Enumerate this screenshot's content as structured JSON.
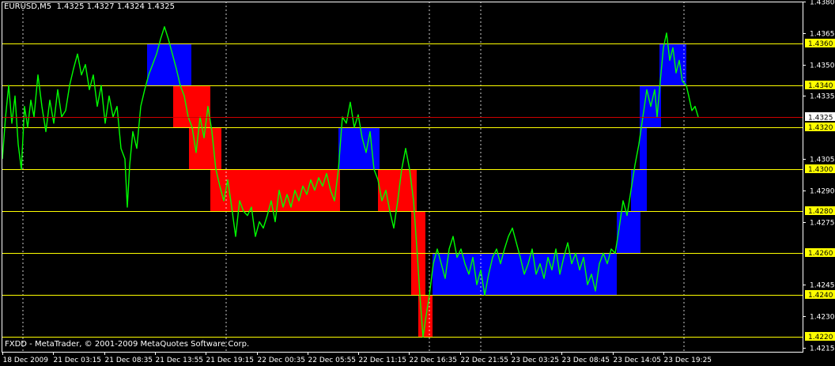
{
  "header": {
    "symbol_tf": "EURUSD,M5",
    "ohlc": "1.4325 1.4327 1.4324 1.4325"
  },
  "footer": {
    "copyright": "FXDD - MetaTrader, © 2001-2009 MetaQuotes Software Corp."
  },
  "colors": {
    "background": "#000000",
    "axis": "#ffffff",
    "price_line": "#00ff00",
    "box_up": "#0000ff",
    "box_down": "#ff0000",
    "level_line": "#ffff00",
    "level_label_bg": "#ffff00",
    "current_price_line": "#cc0000",
    "current_price_label_bg": "#ffffff"
  },
  "chart_data": {
    "type": "line",
    "symbol": "EURUSD",
    "timeframe": "M5",
    "ylim": [
      1.4213,
      1.438
    ],
    "y_axis_labels": [
      "1.4380",
      "1.4365",
      "1.4350",
      "1.4335",
      "1.4305",
      "1.4290",
      "1.4275",
      "1.4245",
      "1.4230",
      "1.4215"
    ],
    "level_labels": [
      "1.4360",
      "1.4340",
      "1.4320",
      "1.4300",
      "1.4280",
      "1.4260",
      "1.4240",
      "1.4220"
    ],
    "current_price": "1.4325",
    "x_tick_labels": [
      "18 Dec 2009",
      "21 Dec 03:15",
      "21 Dec 08:35",
      "21 Dec 13:55",
      "21 Dec 19:15",
      "22 Dec 00:35",
      "22 Dec 05:55",
      "22 Dec 11:15",
      "22 Dec 16:35",
      "22 Dec 21:55",
      "23 Dec 03:25",
      "23 Dec 08:45",
      "23 Dec 14:05",
      "23 Dec 19:25"
    ],
    "vertical_grid_after_tick": [
      0,
      4,
      8,
      9,
      13
    ],
    "grid": "dotted vertical",
    "price_path": [
      [
        0,
        1.4305
      ],
      [
        4,
        1.4325
      ],
      [
        8,
        1.434
      ],
      [
        12,
        1.4322
      ],
      [
        16,
        1.4335
      ],
      [
        20,
        1.4312
      ],
      [
        24,
        1.43
      ],
      [
        28,
        1.433
      ],
      [
        32,
        1.432
      ],
      [
        36,
        1.4333
      ],
      [
        40,
        1.4325
      ],
      [
        45,
        1.4345
      ],
      [
        50,
        1.433
      ],
      [
        55,
        1.4318
      ],
      [
        60,
        1.4333
      ],
      [
        65,
        1.4322
      ],
      [
        70,
        1.4338
      ],
      [
        75,
        1.4325
      ],
      [
        80,
        1.4328
      ],
      [
        85,
        1.434
      ],
      [
        90,
        1.4348
      ],
      [
        95,
        1.4355
      ],
      [
        100,
        1.4345
      ],
      [
        105,
        1.435
      ],
      [
        110,
        1.4338
      ],
      [
        115,
        1.4345
      ],
      [
        120,
        1.433
      ],
      [
        125,
        1.434
      ],
      [
        130,
        1.4322
      ],
      [
        135,
        1.4335
      ],
      [
        140,
        1.4325
      ],
      [
        145,
        1.433
      ],
      [
        150,
        1.431
      ],
      [
        155,
        1.4305
      ],
      [
        158,
        1.4282
      ],
      [
        161,
        1.4302
      ],
      [
        165,
        1.4318
      ],
      [
        170,
        1.431
      ],
      [
        175,
        1.433
      ],
      [
        180,
        1.4338
      ],
      [
        185,
        1.4345
      ],
      [
        190,
        1.435
      ],
      [
        195,
        1.4355
      ],
      [
        200,
        1.4362
      ],
      [
        205,
        1.4368
      ],
      [
        210,
        1.4362
      ],
      [
        215,
        1.4355
      ],
      [
        220,
        1.4348
      ],
      [
        225,
        1.434
      ],
      [
        230,
        1.4335
      ],
      [
        235,
        1.4325
      ],
      [
        240,
        1.432
      ],
      [
        245,
        1.4308
      ],
      [
        250,
        1.4325
      ],
      [
        255,
        1.4315
      ],
      [
        260,
        1.433
      ],
      [
        265,
        1.4318
      ],
      [
        270,
        1.43
      ],
      [
        275,
        1.4292
      ],
      [
        280,
        1.4285
      ],
      [
        285,
        1.4295
      ],
      [
        290,
        1.4282
      ],
      [
        295,
        1.4268
      ],
      [
        300,
        1.4285
      ],
      [
        305,
        1.428
      ],
      [
        310,
        1.4278
      ],
      [
        315,
        1.4282
      ],
      [
        320,
        1.4268
      ],
      [
        325,
        1.4275
      ],
      [
        330,
        1.4272
      ],
      [
        335,
        1.4278
      ],
      [
        340,
        1.4285
      ],
      [
        345,
        1.4275
      ],
      [
        350,
        1.429
      ],
      [
        355,
        1.4282
      ],
      [
        360,
        1.4288
      ],
      [
        365,
        1.4282
      ],
      [
        370,
        1.429
      ],
      [
        375,
        1.4285
      ],
      [
        380,
        1.4292
      ],
      [
        385,
        1.4288
      ],
      [
        390,
        1.4295
      ],
      [
        395,
        1.429
      ],
      [
        400,
        1.4296
      ],
      [
        405,
        1.4292
      ],
      [
        410,
        1.4298
      ],
      [
        415,
        1.429
      ],
      [
        420,
        1.4285
      ],
      [
        425,
        1.43
      ],
      [
        430,
        1.4325
      ],
      [
        435,
        1.4322
      ],
      [
        440,
        1.4332
      ],
      [
        445,
        1.432
      ],
      [
        450,
        1.4326
      ],
      [
        455,
        1.4315
      ],
      [
        460,
        1.4308
      ],
      [
        465,
        1.4318
      ],
      [
        470,
        1.43
      ],
      [
        475,
        1.4295
      ],
      [
        480,
        1.4285
      ],
      [
        485,
        1.429
      ],
      [
        490,
        1.428
      ],
      [
        495,
        1.4272
      ],
      [
        500,
        1.4285
      ],
      [
        505,
        1.43
      ],
      [
        510,
        1.431
      ],
      [
        515,
        1.43
      ],
      [
        520,
        1.4285
      ],
      [
        525,
        1.4258
      ],
      [
        528,
        1.424
      ],
      [
        532,
        1.422
      ],
      [
        535,
        1.4228
      ],
      [
        540,
        1.424
      ],
      [
        545,
        1.4255
      ],
      [
        550,
        1.4262
      ],
      [
        555,
        1.4255
      ],
      [
        560,
        1.4248
      ],
      [
        565,
        1.4262
      ],
      [
        570,
        1.4268
      ],
      [
        575,
        1.4258
      ],
      [
        580,
        1.4262
      ],
      [
        585,
        1.4255
      ],
      [
        590,
        1.425
      ],
      [
        595,
        1.4258
      ],
      [
        600,
        1.4245
      ],
      [
        605,
        1.4252
      ],
      [
        610,
        1.424
      ],
      [
        615,
        1.425
      ],
      [
        620,
        1.4258
      ],
      [
        625,
        1.4262
      ],
      [
        630,
        1.4255
      ],
      [
        635,
        1.4262
      ],
      [
        640,
        1.4268
      ],
      [
        645,
        1.4272
      ],
      [
        650,
        1.4265
      ],
      [
        655,
        1.4258
      ],
      [
        660,
        1.425
      ],
      [
        665,
        1.4255
      ],
      [
        670,
        1.4262
      ],
      [
        675,
        1.425
      ],
      [
        680,
        1.4255
      ],
      [
        685,
        1.4248
      ],
      [
        690,
        1.4258
      ],
      [
        695,
        1.4252
      ],
      [
        700,
        1.4262
      ],
      [
        705,
        1.425
      ],
      [
        710,
        1.4258
      ],
      [
        715,
        1.4265
      ],
      [
        720,
        1.4255
      ],
      [
        725,
        1.426
      ],
      [
        730,
        1.4252
      ],
      [
        735,
        1.4258
      ],
      [
        740,
        1.4245
      ],
      [
        745,
        1.425
      ],
      [
        750,
        1.4242
      ],
      [
        755,
        1.4255
      ],
      [
        760,
        1.426
      ],
      [
        765,
        1.4255
      ],
      [
        770,
        1.4262
      ],
      [
        775,
        1.426
      ],
      [
        780,
        1.4272
      ],
      [
        785,
        1.4285
      ],
      [
        790,
        1.4278
      ],
      [
        795,
        1.429
      ],
      [
        800,
        1.4302
      ],
      [
        805,
        1.4312
      ],
      [
        810,
        1.4325
      ],
      [
        815,
        1.4338
      ],
      [
        820,
        1.433
      ],
      [
        825,
        1.4338
      ],
      [
        828,
        1.4325
      ],
      [
        832,
        1.4342
      ],
      [
        836,
        1.4358
      ],
      [
        840,
        1.4365
      ],
      [
        844,
        1.4352
      ],
      [
        848,
        1.4358
      ],
      [
        852,
        1.4346
      ],
      [
        856,
        1.4352
      ],
      [
        860,
        1.4342
      ],
      [
        865,
        1.434
      ],
      [
        868,
        1.4335
      ],
      [
        872,
        1.4328
      ],
      [
        876,
        1.433
      ],
      [
        880,
        1.4325
      ]
    ],
    "boxes": [
      {
        "x1": 183,
        "x2": 239,
        "low": 1.434,
        "high": 1.436,
        "dir": "up"
      },
      {
        "x1": 216,
        "x2": 263,
        "low": 1.432,
        "high": 1.434,
        "dir": "down"
      },
      {
        "x1": 236,
        "x2": 277,
        "low": 1.43,
        "high": 1.432,
        "dir": "down"
      },
      {
        "x1": 263,
        "x2": 427,
        "low": 1.428,
        "high": 1.43,
        "dir": "down"
      },
      {
        "x1": 425,
        "x2": 477,
        "low": 1.43,
        "high": 1.432,
        "dir": "up"
      },
      {
        "x1": 475,
        "x2": 524,
        "low": 1.428,
        "high": 1.43,
        "dir": "down"
      },
      {
        "x1": 517,
        "x2": 535,
        "low": 1.424,
        "high": 1.428,
        "dir": "down"
      },
      {
        "x1": 526,
        "x2": 544,
        "low": 1.422,
        "high": 1.424,
        "dir": "down"
      },
      {
        "x1": 544,
        "x2": 777,
        "low": 1.424,
        "high": 1.426,
        "dir": "up"
      },
      {
        "x1": 777,
        "x2": 807,
        "low": 1.426,
        "high": 1.428,
        "dir": "up"
      },
      {
        "x1": 795,
        "x2": 815,
        "low": 1.428,
        "high": 1.43,
        "dir": "up"
      },
      {
        "x1": 806,
        "x2": 815,
        "low": 1.43,
        "high": 1.432,
        "dir": "up"
      },
      {
        "x1": 806,
        "x2": 833,
        "low": 1.432,
        "high": 1.434,
        "dir": "up"
      },
      {
        "x1": 831,
        "x2": 865,
        "low": 1.434,
        "high": 1.436,
        "dir": "up"
      }
    ]
  }
}
